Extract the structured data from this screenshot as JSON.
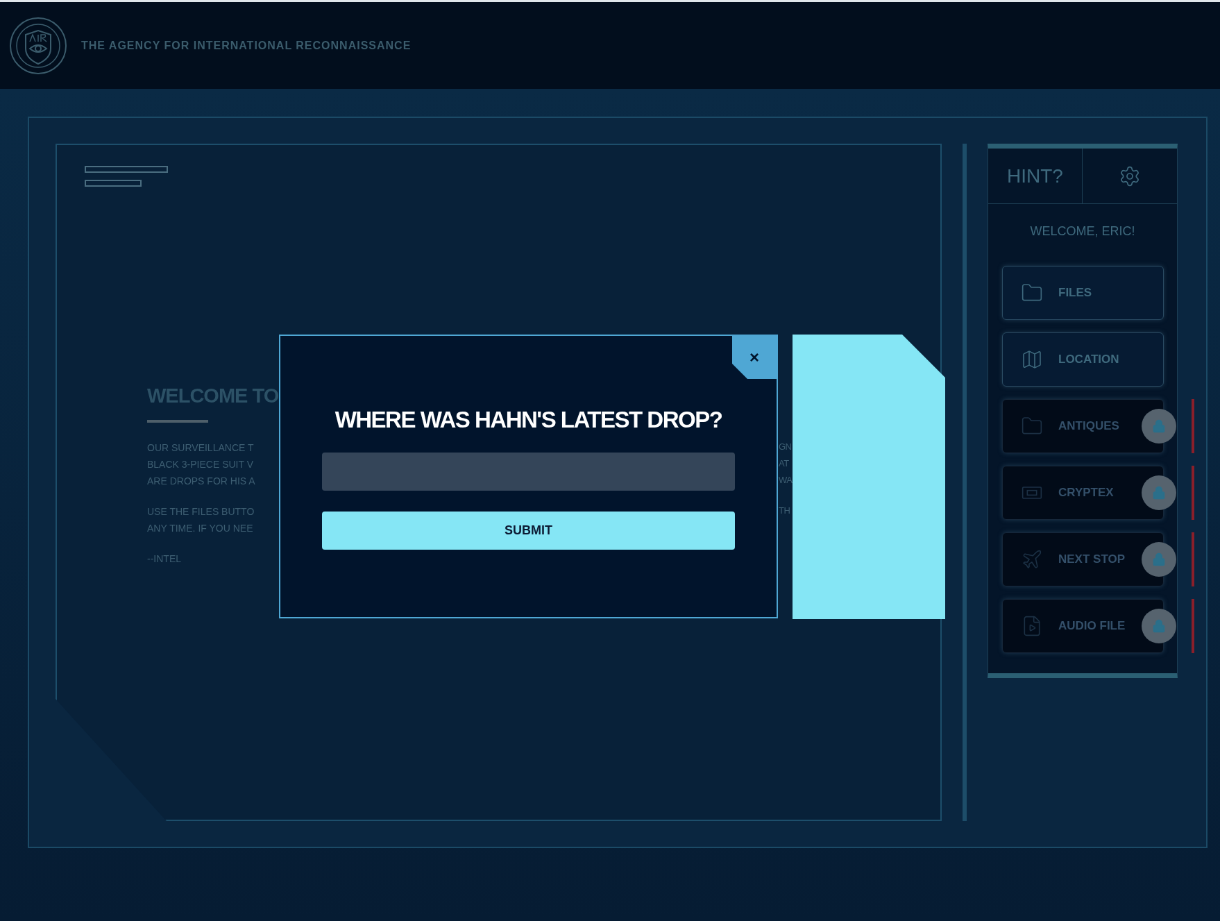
{
  "header": {
    "title": "THE AGENCY FOR INTERNATIONAL RECONNAISSANCE"
  },
  "dashboard": {
    "title": "WELCOME TO",
    "paragraphs": [
      [
        "OUR SURVEILLANCE T",
        "BLACK 3-PIECE SUIT V",
        "ARE DROPS FOR HIS A"
      ],
      [
        "USE THE FILES BUTTO",
        "ANY TIME. IF YOU NEE"
      ],
      [
        "--INTEL"
      ]
    ],
    "right_fragments": [
      [
        "GN",
        "AT",
        "WA"
      ],
      [
        "TH"
      ]
    ]
  },
  "sidebar": {
    "hint": "HINT?",
    "welcome": "WELCOME, ERIC!",
    "items": [
      {
        "label": "FILES",
        "kind": "folder",
        "locked": false
      },
      {
        "label": "LOCATION",
        "kind": "map",
        "locked": false
      },
      {
        "label": "ANTIQUES",
        "kind": "folder",
        "locked": true
      },
      {
        "label": "CRYPTEX",
        "kind": "cryptex",
        "locked": true
      },
      {
        "label": "NEXT STOP",
        "kind": "plane",
        "locked": true
      },
      {
        "label": "AUDIO FILE",
        "kind": "media",
        "locked": true
      }
    ]
  },
  "modal": {
    "close": "×",
    "question": "WHERE WAS HAHN'S LATEST DROP?",
    "submit": "SUBMIT"
  }
}
